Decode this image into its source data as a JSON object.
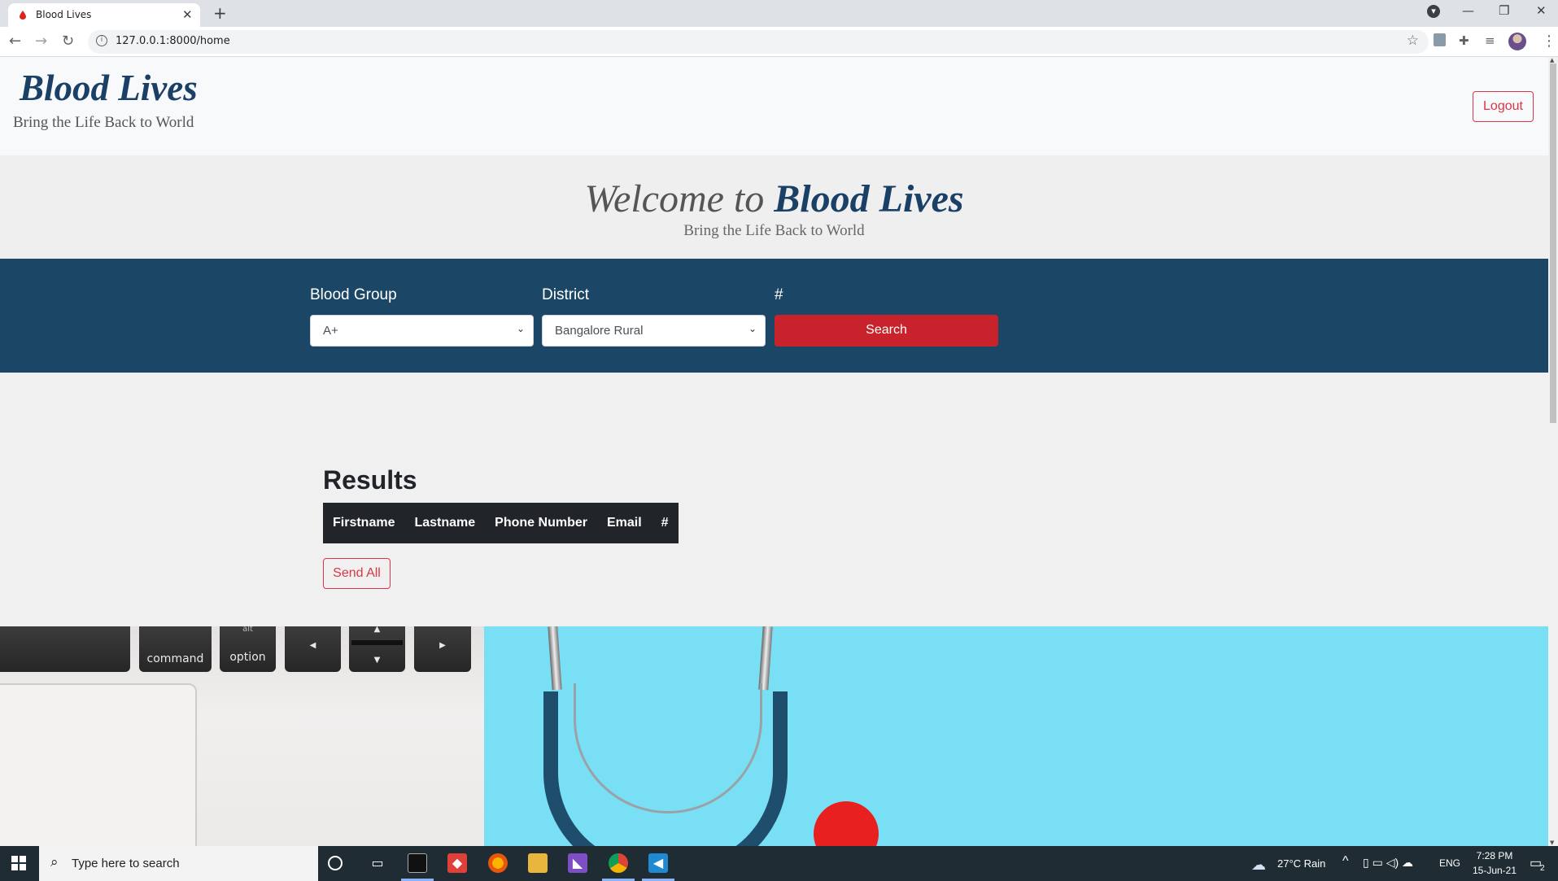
{
  "browser": {
    "tab_title": "Blood Lives",
    "tab_close": "✕",
    "new_tab": "+",
    "url": "127.0.0.1:8000/home",
    "info": "i",
    "controls": {
      "back": "←",
      "forward": "→",
      "reload": "↻",
      "star": "☆",
      "menu": "⋮"
    },
    "window": {
      "profile_menu": "▾",
      "minimize": "—",
      "restore": "❐",
      "close": "✕"
    }
  },
  "navbar": {
    "brand": "Blood Lives",
    "tagline": "Bring the Life Back to World",
    "logout_label": "Logout"
  },
  "hero": {
    "title_prefix": "Welcome to",
    "title_brand": "Blood Lives",
    "subtitle": "Bring the Life Back to World"
  },
  "search_form": {
    "blood_group_label": "Blood Group",
    "blood_group_value": "A+",
    "district_label": "District",
    "district_value": "Bangalore Rural",
    "hash_label": "#",
    "search_label": "Search",
    "chevron": "⌄"
  },
  "results": {
    "title": "Results",
    "columns": [
      "Firstname",
      "Lastname",
      "Phone Number",
      "Email",
      "#"
    ],
    "send_all_label": "Send All"
  },
  "photo": {
    "keys": [
      "command",
      "option",
      "alt",
      "◀",
      "▲",
      "▼",
      "▶"
    ]
  },
  "taskbar": {
    "search_placeholder": "Type here to search",
    "weather": "27°C  Rain",
    "language": "ENG",
    "time": "7:28 PM",
    "date": "15-Jun-21",
    "notifications": "2",
    "chevron_up": "^"
  },
  "colors": {
    "brand": "#1a4066",
    "search_band": "#1c4666",
    "search_button": "#c8232d",
    "danger_outline": "#dc3545"
  }
}
